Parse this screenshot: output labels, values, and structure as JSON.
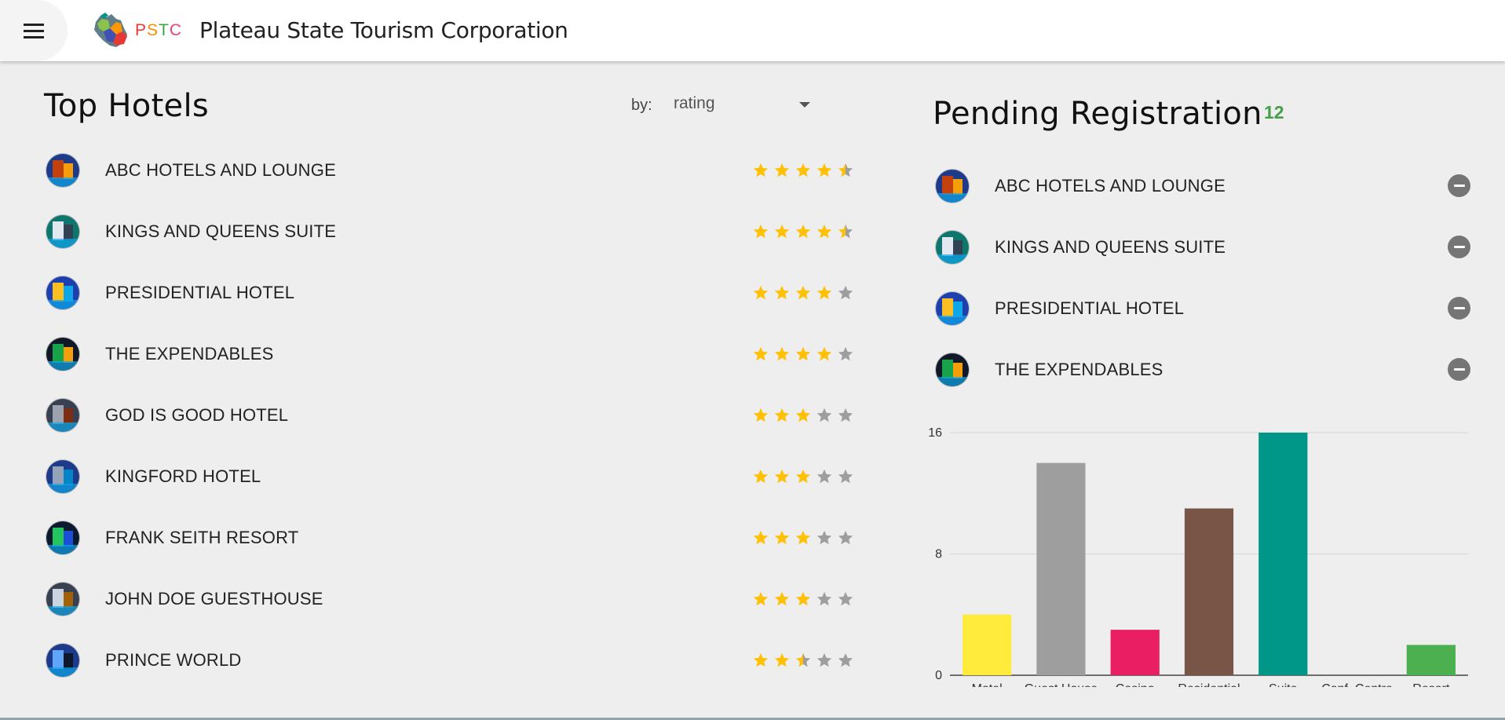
{
  "header": {
    "menu_icon": "hamburger-menu-icon",
    "logo_letters": [
      "P",
      "S",
      "T",
      "C"
    ],
    "title": "Plateau State Tourism Corporation"
  },
  "top_hotels": {
    "title": "Top Hotels",
    "sort_label": "by:",
    "sort_value": "rating",
    "items": [
      {
        "name": "ABC HOTELS AND LOUNGE",
        "rating": 4.5
      },
      {
        "name": "KINGS AND QUEENS SUITE",
        "rating": 4.5
      },
      {
        "name": "PRESIDENTIAL HOTEL",
        "rating": 4
      },
      {
        "name": "THE EXPENDABLES",
        "rating": 4
      },
      {
        "name": "GOD IS GOOD HOTEL",
        "rating": 3
      },
      {
        "name": "KINGFORD HOTEL",
        "rating": 3
      },
      {
        "name": "FRANK SEITH RESORT",
        "rating": 3
      },
      {
        "name": "JOHN DOE GUESTHOUSE",
        "rating": 3
      },
      {
        "name": "PRINCE WORLD",
        "rating": 2.5
      }
    ]
  },
  "pending": {
    "title": "Pending Registration",
    "count": "12",
    "items": [
      {
        "name": "ABC HOTELS AND LOUNGE"
      },
      {
        "name": "KINGS AND QUEENS SUITE"
      },
      {
        "name": "PRESIDENTIAL HOTEL"
      },
      {
        "name": "THE EXPENDABLES"
      }
    ]
  },
  "colors": {
    "star_filled": "#ffc107",
    "star_empty": "#9e9e9e",
    "badge": "#43a047"
  },
  "chart_data": {
    "type": "bar",
    "categories": [
      "Motel",
      "Guest House",
      "Casino",
      "Residential",
      "Suite",
      "Conf..Centre",
      "Resort"
    ],
    "values": [
      4,
      14,
      3,
      11,
      16,
      0,
      2
    ],
    "colors": [
      "#ffeb3b",
      "#9e9e9e",
      "#e91e63",
      "#795548",
      "#009688",
      "#2196f3",
      "#4caf50"
    ],
    "yticks": [
      0,
      8,
      16
    ],
    "ylim": [
      0,
      16
    ],
    "grid": true
  }
}
